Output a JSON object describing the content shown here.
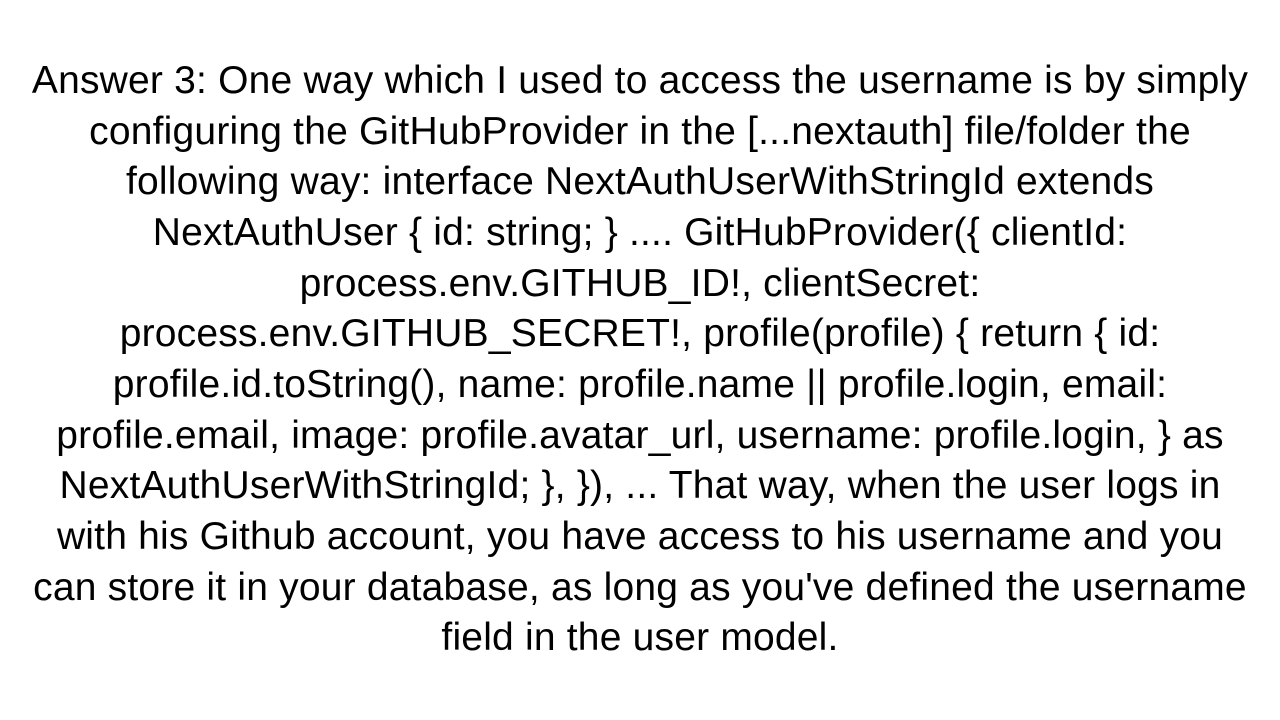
{
  "document": {
    "content": "Answer 3: One way which I used to access the username is by simply configuring the GitHubProvider in the [...nextauth] file/folder the following way: interface NextAuthUserWithStringId extends NextAuthUser {  id: string; }     .... GitHubProvider({   clientId: process.env.GITHUB_ID!,   clientSecret: process.env.GITHUB_SECRET!,   profile(profile) {     return {       id: profile.id.toString(),       name: profile.name || profile.login,       email: profile.email,       image: profile.avatar_url,       username: profile.login,     } as NextAuthUserWithStringId;   }, }), ...  That way, when the user logs in with his Github account, you have access to his username and you can store it in your database, as long as you've defined the username field in the user model."
  }
}
